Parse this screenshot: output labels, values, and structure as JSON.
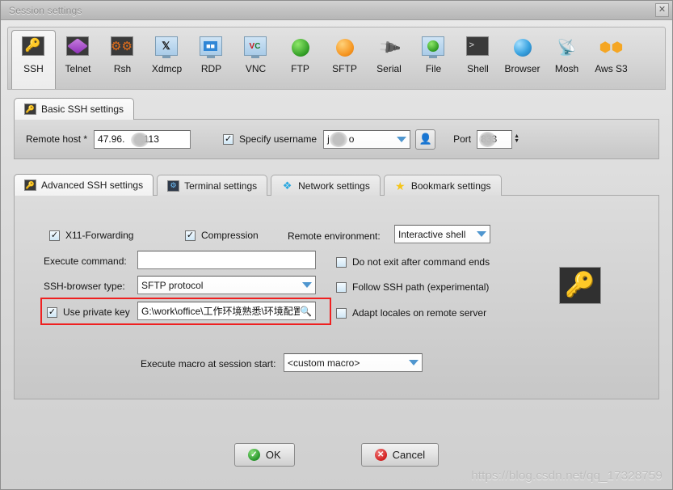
{
  "window": {
    "title": "Session settings",
    "close_label": "✕"
  },
  "protocols": [
    {
      "label": "SSH",
      "icon": "key-icon",
      "active": true
    },
    {
      "label": "Telnet",
      "icon": "cube-icon",
      "active": false
    },
    {
      "label": "Rsh",
      "icon": "gears-icon",
      "active": false
    },
    {
      "label": "Xdmcp",
      "icon": "x-monitor-icon",
      "active": false
    },
    {
      "label": "RDP",
      "icon": "windows-monitor-icon",
      "active": false
    },
    {
      "label": "VNC",
      "icon": "vnc-monitor-icon",
      "active": false
    },
    {
      "label": "FTP",
      "icon": "green-globe-icon",
      "active": false
    },
    {
      "label": "SFTP",
      "icon": "orange-globe-icon",
      "active": false
    },
    {
      "label": "Serial",
      "icon": "serial-plug-icon",
      "active": false
    },
    {
      "label": "File",
      "icon": "file-monitor-icon",
      "active": false
    },
    {
      "label": "Shell",
      "icon": "shell-prompt-icon",
      "active": false
    },
    {
      "label": "Browser",
      "icon": "blue-globe-icon",
      "active": false
    },
    {
      "label": "Mosh",
      "icon": "satellite-icon",
      "active": false
    },
    {
      "label": "Aws S3",
      "icon": "aws-cubes-icon",
      "active": false
    }
  ],
  "basic": {
    "tab_label": "Basic SSH settings",
    "remote_host_label": "Remote host *",
    "remote_host_value": "47.96.      .113",
    "specify_username_label": "Specify username",
    "specify_username_checked": true,
    "username_value": "j  o",
    "port_label": "Port",
    "port_value": "833",
    "user_button_icon": "user-key-icon"
  },
  "adv_tabs": [
    {
      "label": "Advanced SSH settings",
      "icon": "key-icon",
      "active": true
    },
    {
      "label": "Terminal settings",
      "icon": "terminal-icon",
      "active": false
    },
    {
      "label": "Network settings",
      "icon": "network-icon",
      "active": false
    },
    {
      "label": "Bookmark settings",
      "icon": "star-icon",
      "active": false
    }
  ],
  "advanced": {
    "x11_label": "X11-Forwarding",
    "x11_checked": true,
    "compression_label": "Compression",
    "compression_checked": true,
    "remote_env_label": "Remote environment:",
    "remote_env_value": "Interactive shell",
    "execute_command_label": "Execute command:",
    "execute_command_value": "",
    "execute_command_placeholder": "",
    "no_exit_label": "Do not exit after command ends",
    "no_exit_checked": false,
    "browser_type_label": "SSH-browser type:",
    "browser_type_value": "SFTP protocol",
    "follow_path_label": "Follow SSH path (experimental)",
    "follow_path_checked": false,
    "private_key_label": "Use private key",
    "private_key_checked": true,
    "private_key_value": "G:\\work\\office\\工作环境熟悉\\环境配置",
    "private_key_browse_icon": "magnifier-icon",
    "adapt_locales_label": "Adapt locales on remote server",
    "adapt_locales_checked": false,
    "key_badge_icon": "key-icon",
    "macro_label": "Execute macro at session start:",
    "macro_value": "<custom macro>"
  },
  "footer": {
    "ok_label": "OK",
    "cancel_label": "Cancel",
    "ok_icon": "check-circle-icon",
    "cancel_icon": "x-circle-icon",
    "watermark": "https://blog.csdn.net/qq_17328759"
  },
  "colors": {
    "accent_red": "#ef2020",
    "key_yellow": "#f5c518",
    "ok_green": "#27952a",
    "cancel_red": "#d32020"
  }
}
